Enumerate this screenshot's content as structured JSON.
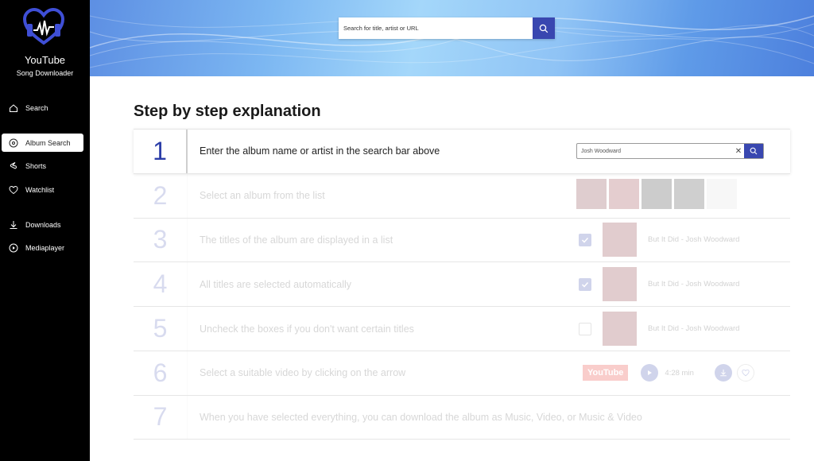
{
  "sidebar": {
    "title": "YouTube",
    "subtitle": "Song Downloader",
    "items": [
      {
        "label": "Search",
        "icon": "home-icon"
      },
      {
        "label": "Album Search",
        "icon": "disc-icon",
        "active": true
      },
      {
        "label": "Shorts",
        "icon": "shorts-icon"
      },
      {
        "label": "Watchlist",
        "icon": "heart-icon"
      },
      {
        "label": "Downloads",
        "icon": "download-icon"
      },
      {
        "label": "Mediaplayer",
        "icon": "play-circle-icon"
      }
    ]
  },
  "header": {
    "search_placeholder": "Search for title, artist or URL"
  },
  "main": {
    "heading": "Step by step explanation",
    "steps": [
      {
        "num": "1",
        "text": "Enter the album name or artist in the search bar above"
      },
      {
        "num": "2",
        "text": "Select an album from the list"
      },
      {
        "num": "3",
        "text": "The titles of the album are displayed in a list"
      },
      {
        "num": "4",
        "text": "All titles are selected automatically"
      },
      {
        "num": "5",
        "text": "Uncheck the boxes if you don't want certain titles"
      },
      {
        "num": "6",
        "text": "Select a suitable video by clicking on the arrow"
      },
      {
        "num": "7",
        "text": "When you have selected everything, you can download the album as Music, Video, or Music & Video"
      }
    ],
    "example_search_value": "Josh Woodward",
    "track_title": "But It Did - Josh Woodward",
    "youtube_badge": "YouTube",
    "duration": "4:28 min"
  },
  "colors": {
    "accent": "#3947b0",
    "step_number": "#2c3ea8",
    "youtube_red": "#e62117",
    "sidebar_bg": "#000000"
  }
}
